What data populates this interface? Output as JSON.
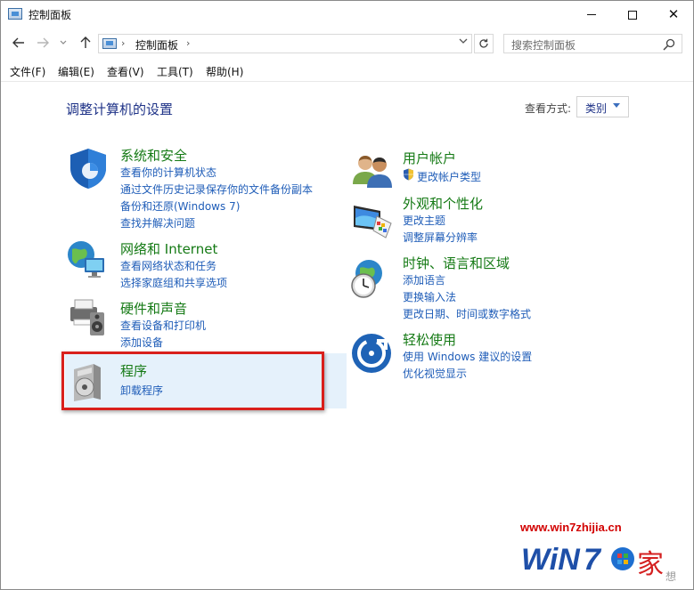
{
  "window": {
    "title": "控制面板",
    "icon": "control-panel-icon"
  },
  "nav": {
    "path": "控制面板",
    "search_placeholder": "搜索控制面板"
  },
  "menu": [
    "文件(F)",
    "编辑(E)",
    "查看(V)",
    "工具(T)",
    "帮助(H)"
  ],
  "main": {
    "title": "调整计算机的设置",
    "view_by_label": "查看方式:",
    "view_by_value": "类别"
  },
  "categories": {
    "system_security": {
      "title": "系统和安全",
      "links": [
        "查看你的计算机状态",
        "通过文件历史记录保存你的文件备份副本",
        "备份和还原(Windows 7)",
        "查找并解决问题"
      ]
    },
    "network": {
      "title": "网络和 Internet",
      "links": [
        "查看网络状态和任务",
        "选择家庭组和共享选项"
      ]
    },
    "hardware": {
      "title": "硬件和声音",
      "links": [
        "查看设备和打印机",
        "添加设备"
      ]
    },
    "programs": {
      "title": "程序",
      "links": [
        "卸载程序"
      ]
    },
    "user_accounts": {
      "title": "用户帐户",
      "links": [
        "更改帐户类型"
      ]
    },
    "appearance": {
      "title": "外观和个性化",
      "links": [
        "更改主题",
        "调整屏幕分辨率"
      ]
    },
    "clock": {
      "title": "时钟、语言和区域",
      "links": [
        "添加语言",
        "更换输入法",
        "更改日期、时间或数字格式"
      ]
    },
    "ease": {
      "title": "轻松使用",
      "links": [
        "使用 Windows 建议的设置",
        "优化视觉显示"
      ]
    }
  },
  "watermark": {
    "url": "www.win7zhijia.cn",
    "logo": "Win7之家"
  },
  "colors": {
    "link": "#1f5db8",
    "category_title": "#157a15",
    "page_title": "#1e3287",
    "highlight": "#e5f1fb",
    "annotation_border": "#d9201c"
  }
}
